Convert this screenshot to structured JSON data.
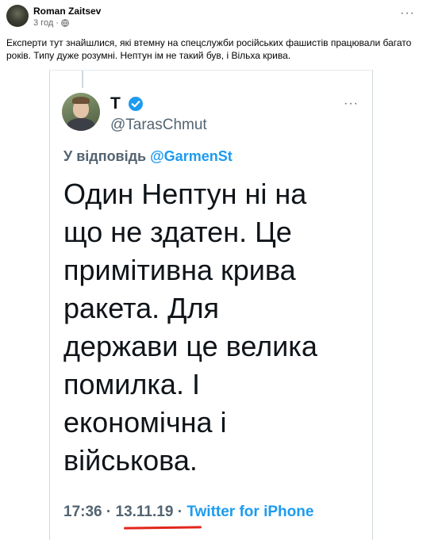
{
  "post": {
    "author": "Roman Zaitsev",
    "time": "3 год",
    "separator": "·",
    "more": "···",
    "text": "Експерти тут знайшлися, які втемну на спецслужби російських фашистів працювали багато років. Типу дуже розумні. Нептун ім не такий був, і Вільха крива."
  },
  "tweet": {
    "name": "T",
    "handle": "@TarasChmut",
    "more": "···",
    "reply_prefix": "У відповідь ",
    "reply_to": "@GarmenSt",
    "body_lines": [
      "Один Нептун ні на",
      "що не здатен. Це",
      "примітивна крива",
      "ракета. Для",
      "держави це велика",
      "помилка. І",
      "економічна і",
      "військова."
    ],
    "time": "17:36",
    "sep1": " · ",
    "date": "13.11.19",
    "sep2": " · ",
    "source": "Twitter for iPhone"
  },
  "colors": {
    "twitter_blue": "#1d9bf0",
    "annotation_red": "#e2261b"
  }
}
